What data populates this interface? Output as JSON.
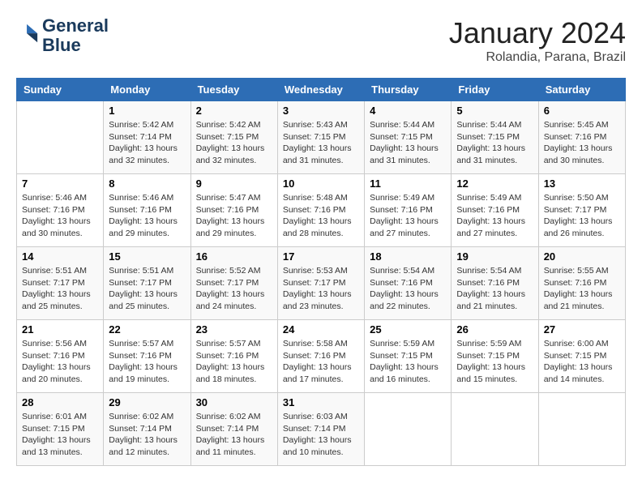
{
  "logo": {
    "line1": "General",
    "line2": "Blue"
  },
  "title": "January 2024",
  "subtitle": "Rolandia, Parana, Brazil",
  "header_days": [
    "Sunday",
    "Monday",
    "Tuesday",
    "Wednesday",
    "Thursday",
    "Friday",
    "Saturday"
  ],
  "weeks": [
    [
      {
        "day": "",
        "detail": ""
      },
      {
        "day": "1",
        "detail": "Sunrise: 5:42 AM\nSunset: 7:14 PM\nDaylight: 13 hours\nand 32 minutes."
      },
      {
        "day": "2",
        "detail": "Sunrise: 5:42 AM\nSunset: 7:15 PM\nDaylight: 13 hours\nand 32 minutes."
      },
      {
        "day": "3",
        "detail": "Sunrise: 5:43 AM\nSunset: 7:15 PM\nDaylight: 13 hours\nand 31 minutes."
      },
      {
        "day": "4",
        "detail": "Sunrise: 5:44 AM\nSunset: 7:15 PM\nDaylight: 13 hours\nand 31 minutes."
      },
      {
        "day": "5",
        "detail": "Sunrise: 5:44 AM\nSunset: 7:15 PM\nDaylight: 13 hours\nand 31 minutes."
      },
      {
        "day": "6",
        "detail": "Sunrise: 5:45 AM\nSunset: 7:16 PM\nDaylight: 13 hours\nand 30 minutes."
      }
    ],
    [
      {
        "day": "7",
        "detail": "Sunrise: 5:46 AM\nSunset: 7:16 PM\nDaylight: 13 hours\nand 30 minutes."
      },
      {
        "day": "8",
        "detail": "Sunrise: 5:46 AM\nSunset: 7:16 PM\nDaylight: 13 hours\nand 29 minutes."
      },
      {
        "day": "9",
        "detail": "Sunrise: 5:47 AM\nSunset: 7:16 PM\nDaylight: 13 hours\nand 29 minutes."
      },
      {
        "day": "10",
        "detail": "Sunrise: 5:48 AM\nSunset: 7:16 PM\nDaylight: 13 hours\nand 28 minutes."
      },
      {
        "day": "11",
        "detail": "Sunrise: 5:49 AM\nSunset: 7:16 PM\nDaylight: 13 hours\nand 27 minutes."
      },
      {
        "day": "12",
        "detail": "Sunrise: 5:49 AM\nSunset: 7:16 PM\nDaylight: 13 hours\nand 27 minutes."
      },
      {
        "day": "13",
        "detail": "Sunrise: 5:50 AM\nSunset: 7:17 PM\nDaylight: 13 hours\nand 26 minutes."
      }
    ],
    [
      {
        "day": "14",
        "detail": "Sunrise: 5:51 AM\nSunset: 7:17 PM\nDaylight: 13 hours\nand 25 minutes."
      },
      {
        "day": "15",
        "detail": "Sunrise: 5:51 AM\nSunset: 7:17 PM\nDaylight: 13 hours\nand 25 minutes."
      },
      {
        "day": "16",
        "detail": "Sunrise: 5:52 AM\nSunset: 7:17 PM\nDaylight: 13 hours\nand 24 minutes."
      },
      {
        "day": "17",
        "detail": "Sunrise: 5:53 AM\nSunset: 7:17 PM\nDaylight: 13 hours\nand 23 minutes."
      },
      {
        "day": "18",
        "detail": "Sunrise: 5:54 AM\nSunset: 7:16 PM\nDaylight: 13 hours\nand 22 minutes."
      },
      {
        "day": "19",
        "detail": "Sunrise: 5:54 AM\nSunset: 7:16 PM\nDaylight: 13 hours\nand 21 minutes."
      },
      {
        "day": "20",
        "detail": "Sunrise: 5:55 AM\nSunset: 7:16 PM\nDaylight: 13 hours\nand 21 minutes."
      }
    ],
    [
      {
        "day": "21",
        "detail": "Sunrise: 5:56 AM\nSunset: 7:16 PM\nDaylight: 13 hours\nand 20 minutes."
      },
      {
        "day": "22",
        "detail": "Sunrise: 5:57 AM\nSunset: 7:16 PM\nDaylight: 13 hours\nand 19 minutes."
      },
      {
        "day": "23",
        "detail": "Sunrise: 5:57 AM\nSunset: 7:16 PM\nDaylight: 13 hours\nand 18 minutes."
      },
      {
        "day": "24",
        "detail": "Sunrise: 5:58 AM\nSunset: 7:16 PM\nDaylight: 13 hours\nand 17 minutes."
      },
      {
        "day": "25",
        "detail": "Sunrise: 5:59 AM\nSunset: 7:15 PM\nDaylight: 13 hours\nand 16 minutes."
      },
      {
        "day": "26",
        "detail": "Sunrise: 5:59 AM\nSunset: 7:15 PM\nDaylight: 13 hours\nand 15 minutes."
      },
      {
        "day": "27",
        "detail": "Sunrise: 6:00 AM\nSunset: 7:15 PM\nDaylight: 13 hours\nand 14 minutes."
      }
    ],
    [
      {
        "day": "28",
        "detail": "Sunrise: 6:01 AM\nSunset: 7:15 PM\nDaylight: 13 hours\nand 13 minutes."
      },
      {
        "day": "29",
        "detail": "Sunrise: 6:02 AM\nSunset: 7:14 PM\nDaylight: 13 hours\nand 12 minutes."
      },
      {
        "day": "30",
        "detail": "Sunrise: 6:02 AM\nSunset: 7:14 PM\nDaylight: 13 hours\nand 11 minutes."
      },
      {
        "day": "31",
        "detail": "Sunrise: 6:03 AM\nSunset: 7:14 PM\nDaylight: 13 hours\nand 10 minutes."
      },
      {
        "day": "",
        "detail": ""
      },
      {
        "day": "",
        "detail": ""
      },
      {
        "day": "",
        "detail": ""
      }
    ]
  ]
}
